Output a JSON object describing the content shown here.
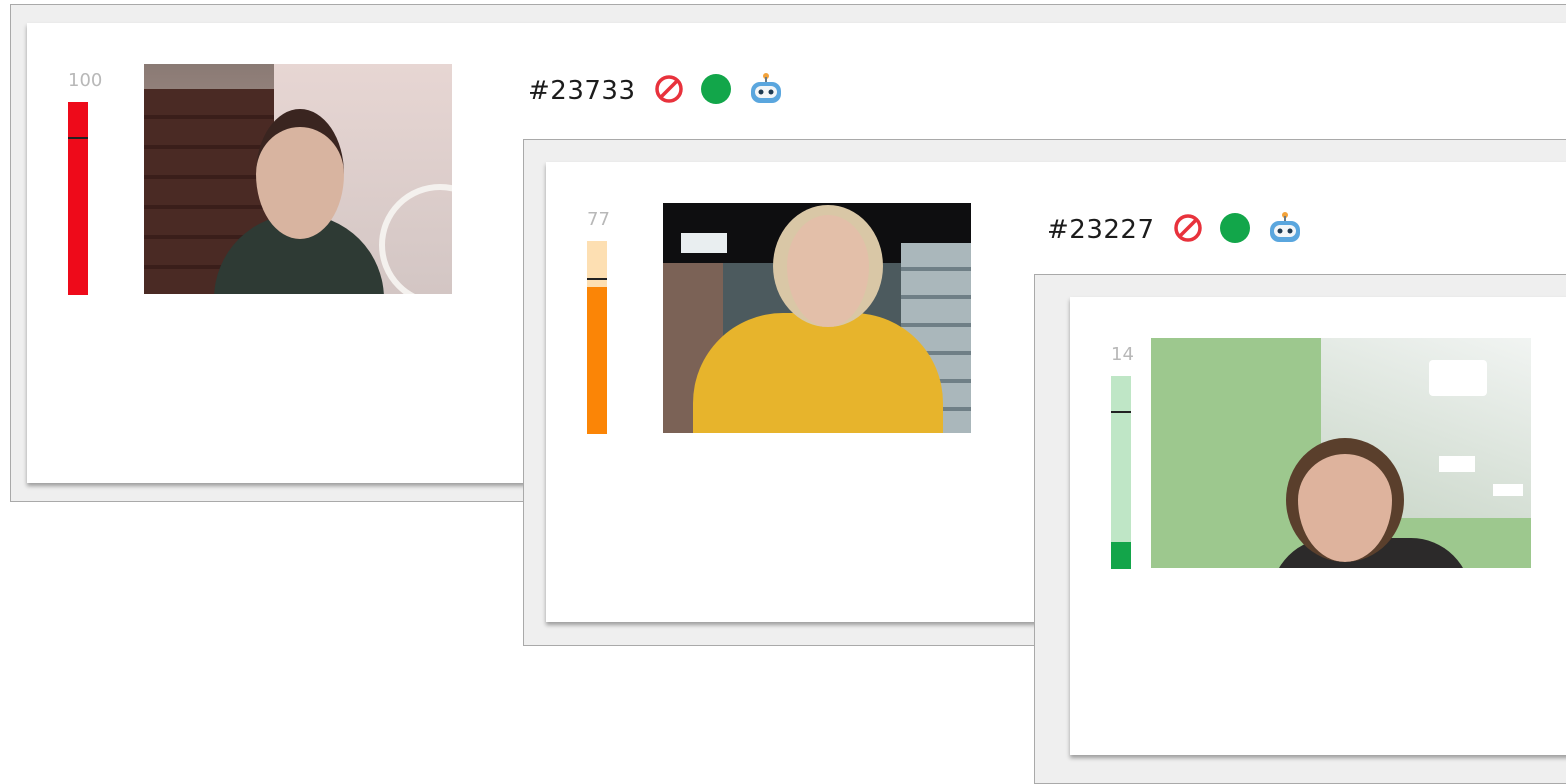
{
  "participants": [
    {
      "id_label": "#23733",
      "score": "100",
      "meter": {
        "fill_fraction": 1.0,
        "threshold_fraction": 0.82,
        "fill_color": "#ee0a1a",
        "track_color": "#ee0a1a"
      },
      "status_icons": [
        "blocked-icon",
        "online-dot-icon",
        "robot-icon"
      ],
      "camera": {
        "description_icon": "webcam-video-feed"
      }
    },
    {
      "id_label": "#23227",
      "score": "77",
      "meter": {
        "fill_fraction": 0.76,
        "threshold_fraction": 0.8,
        "fill_color": "#fb8506",
        "track_color": "#fddfb2"
      },
      "status_icons": [
        "blocked-icon",
        "online-dot-icon",
        "robot-icon"
      ],
      "camera": {
        "description_icon": "webcam-video-feed"
      }
    },
    {
      "id_label": "",
      "score": "14",
      "meter": {
        "fill_fraction": 0.14,
        "threshold_fraction": 0.82,
        "fill_color": "#13a54a",
        "track_color": "#bfe6c6"
      },
      "status_icons": [],
      "camera": {
        "description_icon": "webcam-video-feed"
      }
    }
  ],
  "colors": {
    "blocked": "#e8323c",
    "online": "#12a64a",
    "robot": "#3a8fd0"
  }
}
